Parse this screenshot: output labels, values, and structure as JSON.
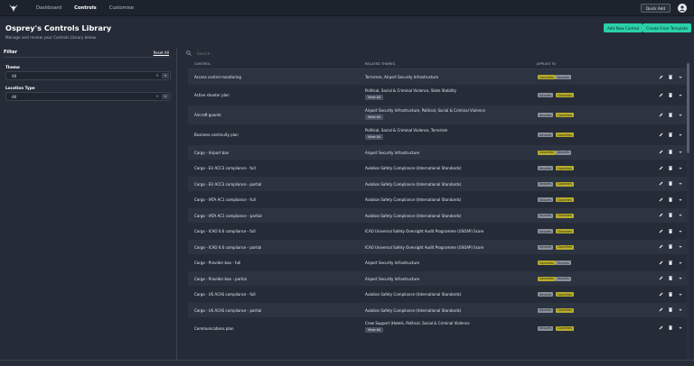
{
  "nav": {
    "items": [
      {
        "label": "Dashboard",
        "active": false
      },
      {
        "label": "Controls",
        "active": true
      },
      {
        "label": "Customise",
        "active": false
      }
    ],
    "quick_add": "Quick Add"
  },
  "header": {
    "title": "Osprey's Controls Library",
    "subtitle": "Manage and review your Controls Library below.",
    "add_button": "Add New Control",
    "template_button": "Create From Template"
  },
  "filter": {
    "title": "Filter",
    "reset": "Reset All",
    "theme_label": "Theme",
    "theme_value": "All",
    "location_label": "Location Type",
    "location_value": "All"
  },
  "search": {
    "placeholder": "Search..."
  },
  "table": {
    "headers": [
      "CONTROL",
      "RELATED THEMES",
      "APPLIES TO"
    ],
    "view_all_label": "View All",
    "badge_colors": {
      "Countries": "#b7ad2e",
      "Airports": "#8a9099"
    },
    "rows": [
      {
        "control": "Access control monitoring",
        "themes": "Terrorism, Airport Security Infrastructure",
        "view_all": false,
        "applies": [
          "Countries",
          "Airports"
        ]
      },
      {
        "control": "Active shooter plan",
        "themes": "Political, Social & Criminal Violence, State Stability",
        "view_all": true,
        "applies": [
          "Airports",
          "Countries"
        ]
      },
      {
        "control": "Aircraft guards",
        "themes": "Airport Security Infrastructure, Political, Social & Criminal Violence",
        "view_all": true,
        "applies": [
          "Airports",
          "Countries"
        ]
      },
      {
        "control": "Business continuity plan",
        "themes": "Political, Social & Criminal Violence, Terrorism",
        "view_all": true,
        "applies": [
          "Airports",
          "Countries"
        ]
      },
      {
        "control": "Cargo - Airport ban",
        "themes": "Airport Security Infrastructure",
        "view_all": false,
        "applies": [
          "Countries",
          "Airports"
        ]
      },
      {
        "control": "Cargo - EU ACC3 compliance - full",
        "themes": "Aviation Safety Compliance (International Standards)",
        "view_all": false,
        "applies": [
          "Airports",
          "Countries"
        ]
      },
      {
        "control": "Cargo - EU ACC3 compliance - partial",
        "themes": "Aviation Safety Compliance (International Standards)",
        "view_all": false,
        "applies": [
          "Airports",
          "Countries"
        ]
      },
      {
        "control": "Cargo - IATA AC1 compliance - full",
        "themes": "Aviation Safety Compliance (International Standards)",
        "view_all": false,
        "applies": [
          "Airports",
          "Countries"
        ]
      },
      {
        "control": "Cargo - IATA AC1 compliance - partial",
        "themes": "Aviation Safety Compliance (International Standards)",
        "view_all": false,
        "applies": [
          "Airports",
          "Countries"
        ]
      },
      {
        "control": "Cargo - ICAO 6.6 compliance - full",
        "themes": "ICAO Universal Safety Oversight Audit Programme (USOAP) Score",
        "view_all": false,
        "applies": [
          "Airports",
          "Countries"
        ]
      },
      {
        "control": "Cargo - ICAO 6.6 compliance - partial",
        "themes": "ICAO Universal Safety Oversight Audit Programme (USOAP) Score",
        "view_all": false,
        "applies": [
          "Airports",
          "Countries"
        ]
      },
      {
        "control": "Cargo - Provider ban - full",
        "themes": "Airport Security Infrastructure",
        "view_all": false,
        "applies": [
          "Countries",
          "Airports"
        ]
      },
      {
        "control": "Cargo - Provider ban - partial",
        "themes": "Airport Security Infrastructure",
        "view_all": false,
        "applies": [
          "Countries",
          "Airports"
        ]
      },
      {
        "control": "Cargo - US ACAS compliance - full",
        "themes": "Aviation Safety Compliance (International Standards)",
        "view_all": false,
        "applies": [
          "Airports",
          "Countries"
        ]
      },
      {
        "control": "Cargo - US ACAS compliance - partial",
        "themes": "Aviation Safety Compliance (International Standards)",
        "view_all": false,
        "applies": [
          "Airports",
          "Countries"
        ]
      },
      {
        "control": "Communications plan",
        "themes": "Crew Support (Hotels, Political, Social & Criminal Violence",
        "view_all": true,
        "applies": [
          "Airports",
          "Countries"
        ]
      }
    ]
  }
}
